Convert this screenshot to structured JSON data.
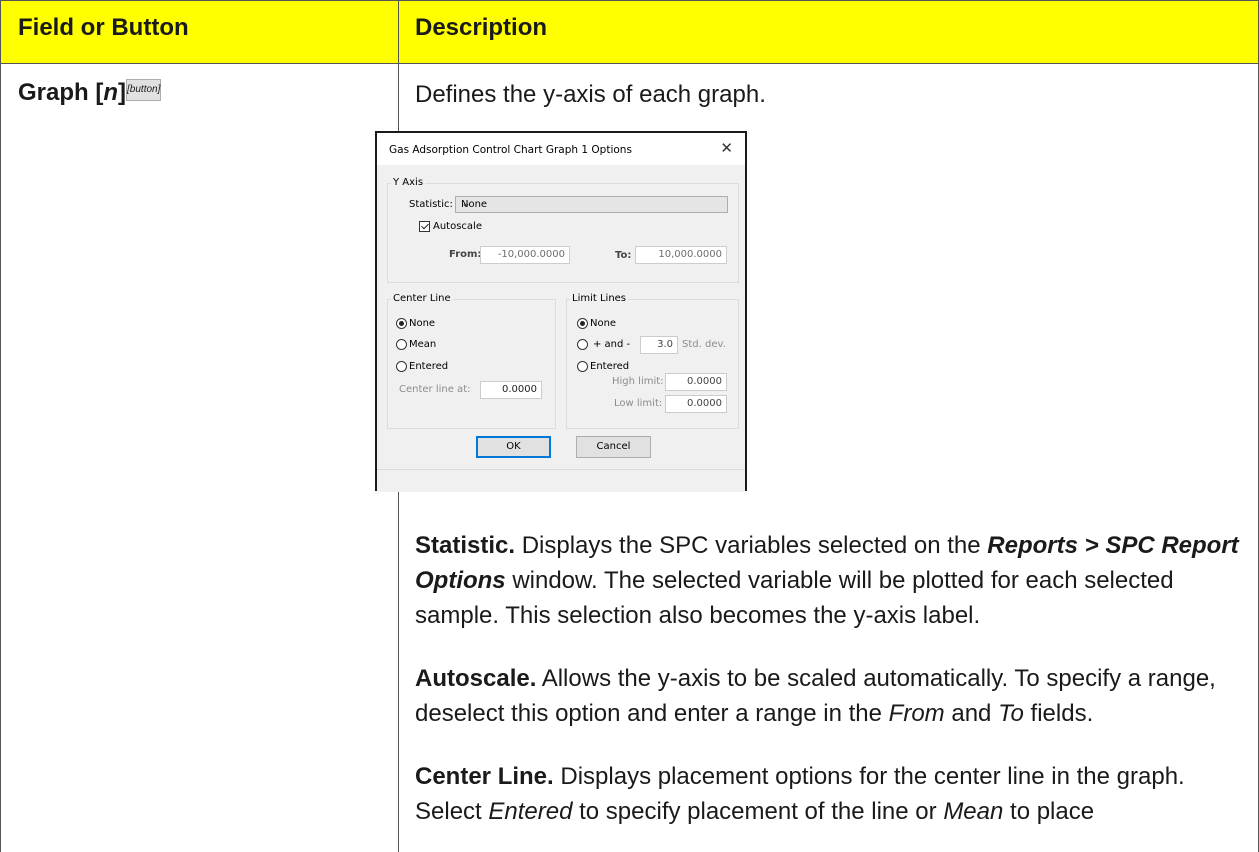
{
  "table": {
    "header_left": "Field or Button",
    "header_right": "Description",
    "header_color": "#ffff00"
  },
  "row": {
    "field_name": "Graph [",
    "field_var": "n",
    "field_close": "]",
    "field_type": "[button]",
    "intro": "Defines the y-axis of each graph."
  },
  "dialog": {
    "title": "Gas Adsorption Control Chart Graph 1 Options",
    "close_icon": "close-icon",
    "y_axis_group": "Y Axis",
    "statistic_label": "Statistic:",
    "statistic_value": "None",
    "autoscale_label": "Autoscale",
    "autoscale_checked": true,
    "from_label": "From:",
    "from_value": "-10,000.0000",
    "to_label": "To:",
    "to_value": "10,000.0000",
    "center_group": "Center Line",
    "center_none": "None",
    "center_mean": "Mean",
    "center_entered": "Entered",
    "center_at_label": "Center line at:",
    "center_at_value": "0.0000",
    "limit_group": "Limit Lines",
    "limit_none": "None",
    "limit_plusminus": "+ and -",
    "limit_std_value": "3.0",
    "limit_std_label": "Std. dev.",
    "limit_entered": "Entered",
    "high_label": "High limit:",
    "high_value": "0.0000",
    "low_label": "Low limit:",
    "low_value": "0.0000",
    "ok_label": "OK",
    "cancel_label": "Cancel"
  },
  "paragraphs": {
    "statistic_term": "Statistic.",
    "statistic_text1": " Displays the SPC variables selected on the ",
    "statistic_menu": "Reports > SPC Report Options",
    "statistic_text2": " window. The selected variable will be plotted for each selected sample. This selection also becomes the y-axis label.",
    "autoscale_term": "Autoscale.",
    "autoscale_text1": " Allows the y-axis to be scaled automatically. To specify a range, deselect this option and enter a range in the ",
    "autoscale_from": "From",
    "autoscale_and": " and ",
    "autoscale_to": "To",
    "autoscale_text2": " fields.",
    "center_term": "Center Line.",
    "center_text1": " Displays placement options for the center line in the graph. Select ",
    "center_entered": "Entered",
    "center_text2": " to specify placement of the line or ",
    "center_mean": "Mean",
    "center_text3": " to place"
  }
}
